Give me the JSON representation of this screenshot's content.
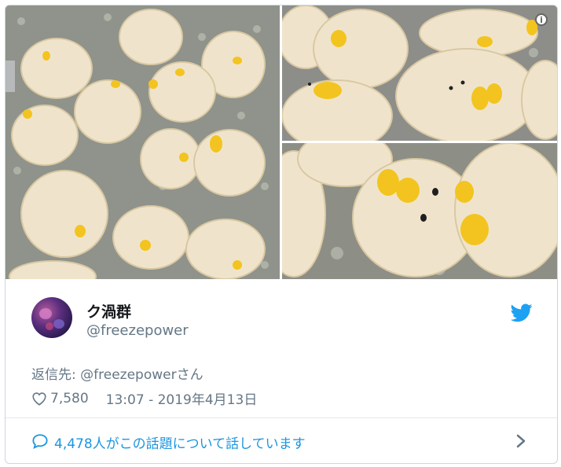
{
  "tweet": {
    "display_name": "ク渦群",
    "handle": "@freezepower",
    "reply_to": "返信先: @freezepowerさん",
    "likes": "7,580",
    "timestamp": "13:07 - 2019年4月13日",
    "conversation": "4,478人がこの話題について話しています"
  },
  "icons": {
    "info": "info-icon",
    "bird": "twitter-bird-icon",
    "heart": "heart-icon",
    "speech": "speech-bubble-icon",
    "chevron": "chevron-right-icon",
    "info_glyph": "i"
  },
  "colors": {
    "twitter_blue": "#1da1f2",
    "link_blue": "#1b95e0",
    "secondary_text": "#657786",
    "border": "#ccd6dd"
  }
}
